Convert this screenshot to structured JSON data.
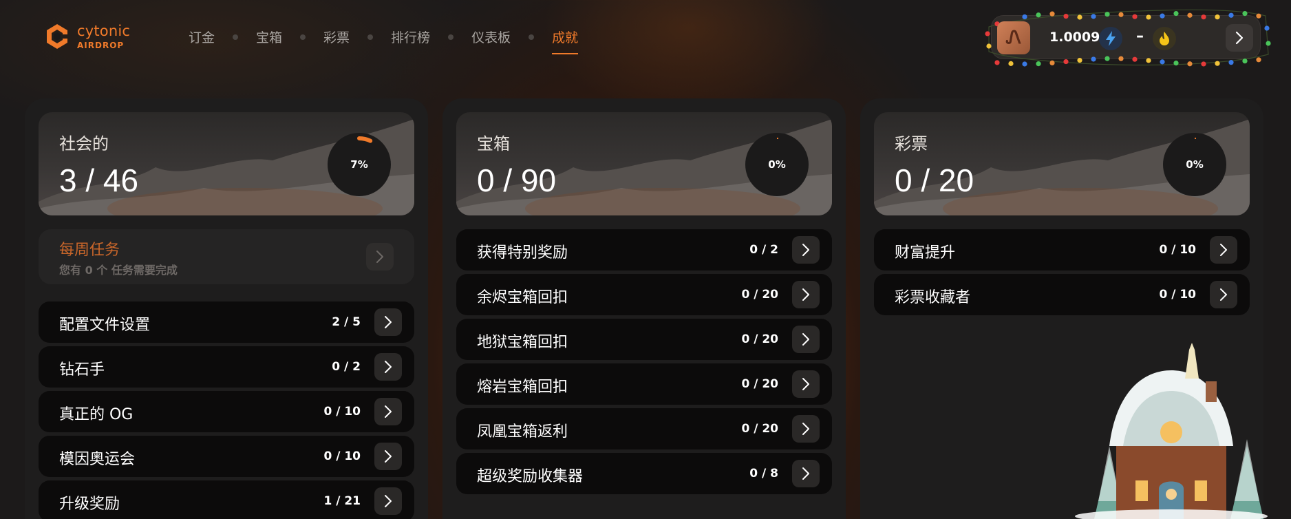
{
  "brand": {
    "name": "cytonic",
    "sub": "AIRDROP",
    "color": "#f07a2a"
  },
  "nav": {
    "items": [
      {
        "label": "订金",
        "active": false
      },
      {
        "label": "宝箱",
        "active": false
      },
      {
        "label": "彩票",
        "active": false
      },
      {
        "label": "排行榜",
        "active": false
      },
      {
        "label": "仪表板",
        "active": false
      },
      {
        "label": "成就",
        "active": true
      }
    ]
  },
  "wallet": {
    "avatar_glyph": "Ꮑ",
    "balance": "1.0009",
    "streak": "–",
    "icons": [
      "bolt-icon",
      "flame-icon",
      "chevron-right-icon"
    ]
  },
  "sections": [
    {
      "title": "社会的",
      "count": "3 / 46",
      "percent_label": "7%",
      "progress": 0.07,
      "weekly": {
        "title": "每周任务",
        "subtitle": "您有 0 个 任务需要完成"
      },
      "rows": [
        {
          "label": "配置文件设置",
          "count": "2 / 5"
        },
        {
          "label": "钻石手",
          "count": "0 / 2"
        },
        {
          "label": "真正的 OG",
          "count": "0 / 10"
        },
        {
          "label": "模因奥运会",
          "count": "0 / 10"
        },
        {
          "label": "升级奖励",
          "count": "1 / 21"
        }
      ]
    },
    {
      "title": "宝箱",
      "count": "0 / 90",
      "percent_label": "0%",
      "progress": 0.0,
      "rows": [
        {
          "label": "获得特别奖励",
          "count": "0 / 2"
        },
        {
          "label": "余烬宝箱回扣",
          "count": "0 / 20"
        },
        {
          "label": "地狱宝箱回扣",
          "count": "0 / 20"
        },
        {
          "label": "熔岩宝箱回扣",
          "count": "0 / 20"
        },
        {
          "label": "凤凰宝箱返利",
          "count": "0 / 20"
        },
        {
          "label": "超级奖励收集器",
          "count": "0 / 8"
        }
      ]
    },
    {
      "title": "彩票",
      "count": "0 / 20",
      "percent_label": "0%",
      "progress": 0.0,
      "rows": [
        {
          "label": "财富提升",
          "count": "0 / 10"
        },
        {
          "label": "彩票收藏者",
          "count": "0 / 10"
        }
      ]
    }
  ],
  "colors": {
    "accent": "#f07a2a",
    "background": "#1b1919",
    "card": "#1e1d1d",
    "row": "#0c0b0b",
    "weekly_title": "#c9662a"
  }
}
